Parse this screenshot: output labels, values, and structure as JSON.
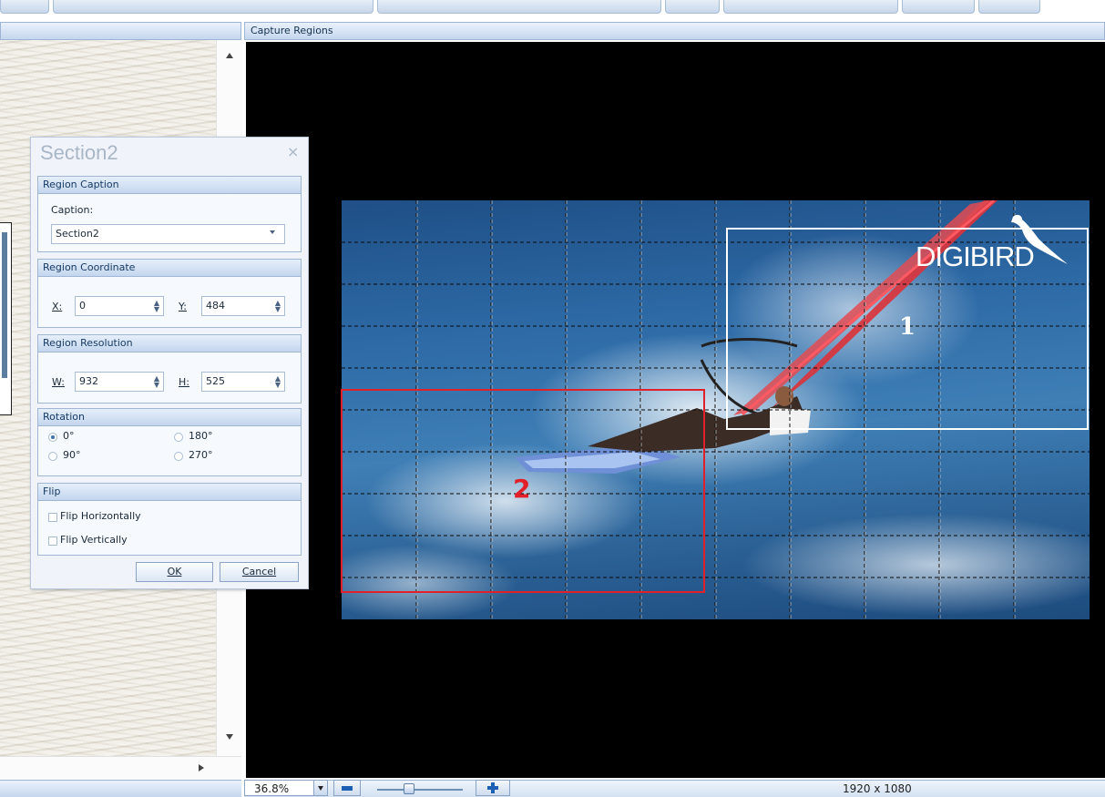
{
  "canvas_panel": {
    "title": "Capture Regions"
  },
  "image": {
    "logo": "DIGIBIRD",
    "regions": [
      {
        "label": "1",
        "color": "#ffffff"
      },
      {
        "label": "2",
        "color": "#e2202a"
      }
    ],
    "resolution": "1920 x 1080"
  },
  "status": {
    "zoom": "36.8%"
  },
  "dialog": {
    "title": "Section2",
    "caption_group": {
      "header": "Region Caption",
      "caption_label": "Caption:",
      "caption_value": "Section2"
    },
    "coord_group": {
      "header": "Region Coordinate",
      "x_label": "X:",
      "x_value": "0",
      "y_label": "Y:",
      "y_value": "484"
    },
    "res_group": {
      "header": "Region Resolution",
      "w_label": "W:",
      "w_value": "932",
      "h_label": "H:",
      "h_value": "525"
    },
    "rotation_group": {
      "header": "Rotation",
      "options": [
        "0°",
        "180°",
        "90°",
        "270°"
      ],
      "selected": "0°"
    },
    "flip_group": {
      "header": "Flip",
      "flip_h": "Flip Horizontally",
      "flip_v": "Flip Vertically"
    },
    "ok": "OK",
    "cancel": "Cancel"
  }
}
